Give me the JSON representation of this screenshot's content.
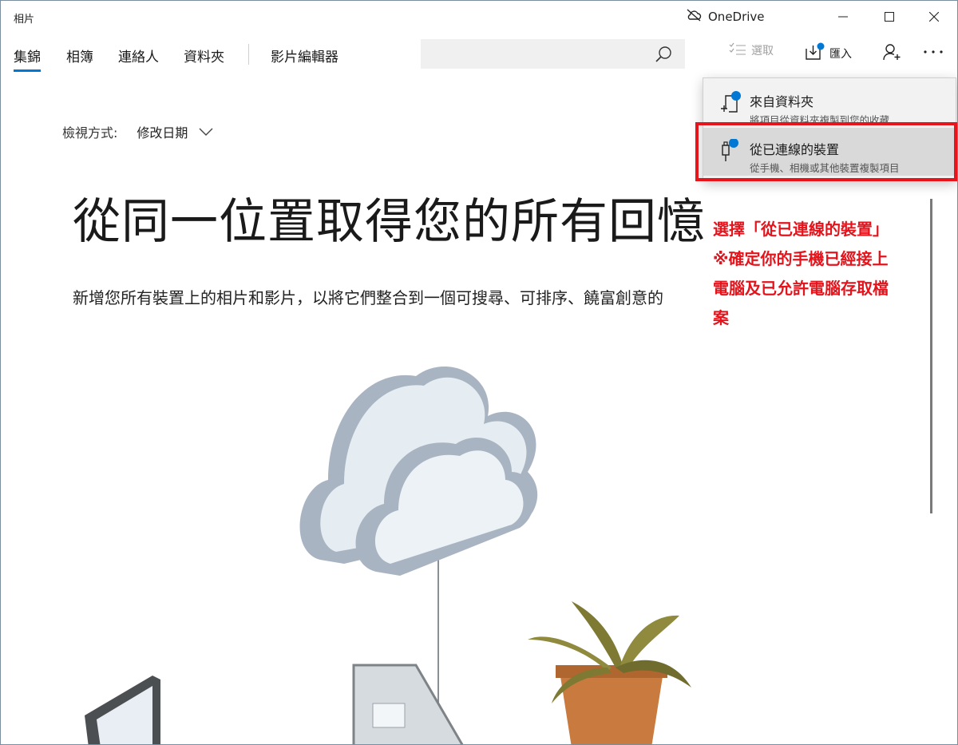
{
  "window": {
    "title": "相片",
    "onedrive_label": "OneDrive"
  },
  "nav": {
    "items": [
      "集錦",
      "相簿",
      "連絡人",
      "資料夾"
    ],
    "video_editor": "影片編輯器"
  },
  "search": {
    "placeholder": ""
  },
  "toolbar": {
    "select_label": "選取",
    "import_label": "匯入"
  },
  "import_menu": {
    "items": [
      {
        "title": "來自資料夾",
        "description": "將項目從資料夾複製到您的收藏"
      },
      {
        "title": "從已連線的裝置",
        "description": "從手機、相機或其他裝置複製項目"
      }
    ]
  },
  "main": {
    "view_by_label": "檢視方式:",
    "view_by_value": "修改日期",
    "headline": "從同一位置取得您的所有回憶",
    "subtext": "新增您所有裝置上的相片和影片，以將它們整合到一個可搜尋、可排序、饒富創意的"
  },
  "annotation": {
    "lines": [
      "選擇「從已連線的裝置」",
      "※確定你的手機已經接上",
      "電腦及已允許電腦存取檔",
      "案"
    ]
  },
  "colors": {
    "accent": "#0078d4",
    "annotation_red": "#e3141c"
  }
}
